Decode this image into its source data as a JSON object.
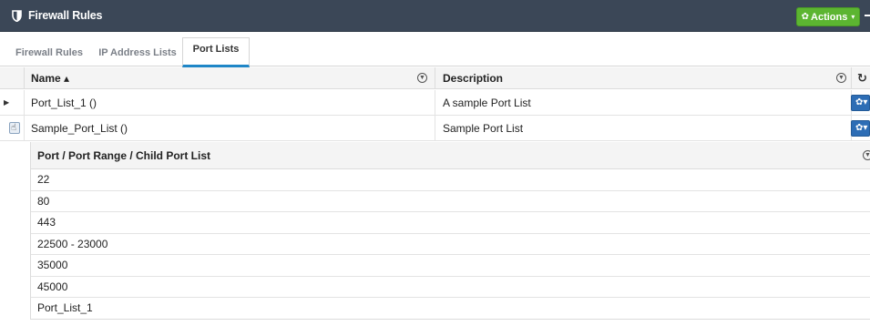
{
  "titlebar": {
    "title": "Firewall Rules",
    "actions_label": "Actions",
    "accent_color": "#5cb531",
    "bar_color": "#3b4757"
  },
  "tabs": [
    {
      "label": "Firewall Rules",
      "active": false
    },
    {
      "label": "IP Address Lists",
      "active": false
    },
    {
      "label": "Port Lists",
      "active": true
    }
  ],
  "grid": {
    "columns": {
      "name": "Name ▴",
      "description": "Description"
    },
    "rows": [
      {
        "name": "Port_List_1 ()",
        "description": "A sample Port List",
        "expanded": false
      },
      {
        "name": "Sample_Port_List ()",
        "description": "Sample Port List",
        "expanded": true
      }
    ]
  },
  "subgrid": {
    "header": "Port / Port Range / Child Port List",
    "items": [
      "22",
      "80",
      "443",
      "22500 - 23000",
      "35000",
      "45000",
      "Port_List_1"
    ]
  },
  "icons": {
    "title": "shield-icon",
    "actions": "gear-icon",
    "filter": "filter-icon",
    "refresh": "refresh-icon",
    "row_menu": "gear-icon"
  }
}
